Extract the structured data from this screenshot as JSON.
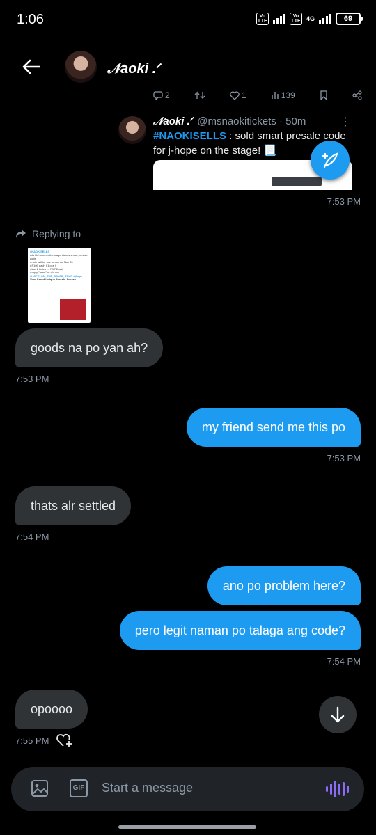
{
  "status_bar": {
    "time": "1:06",
    "volte_label": "Vo LTE",
    "network": "4G",
    "battery": "69"
  },
  "header": {
    "contact_name": "𝒩aoki .ᐟ"
  },
  "quoted_tweet": {
    "actions": {
      "replies": "2",
      "likes": "1",
      "views": "139"
    },
    "author": "𝒩aoki .ᐟ",
    "handle_time": "@msnaokitickets · 50m",
    "hashtag": "#NAOKISELLS",
    "text": " : sold smart presale code for j-hope on the stage! 📃",
    "timestamp": "7:53 PM"
  },
  "replying_to": {
    "label": "Replying to",
    "thumb_title": "#NAOKISELLS",
    "thumb_line1": "wts fib hope on the stage stands smart presale code",
    "thumb_line2": "• note will be use tomorrow Nov 20",
    "thumb_line3": "• P100 each ( 1 pcs )",
    "thumb_line4": "• last 2 batch → P1/P2 only",
    "thumb_line5": "• reply \"mine\" or d/o me",
    "thumb_tags": "#HOPE_ON_THE_STAGE_TOUR #jhope",
    "thumb_card": "Your Smart Unique Presale Access..."
  },
  "messages": [
    {
      "direction": "in",
      "text": "goods na po yan ah?",
      "time": "7:53 PM"
    },
    {
      "direction": "out",
      "text": "my friend send me this po",
      "time": "7:53 PM"
    },
    {
      "direction": "in",
      "text": "thats alr settled",
      "time": "7:54 PM"
    },
    {
      "direction": "out",
      "text": "ano po problem here?",
      "time": ""
    },
    {
      "direction": "out",
      "text": "pero legit naman po talaga ang code?",
      "time": "7:54 PM"
    },
    {
      "direction": "in",
      "text": "opoooo",
      "time": "7:55 PM"
    }
  ],
  "composer": {
    "placeholder": "Start a message",
    "gif_label": "GIF"
  },
  "colors": {
    "accent": "#1d9bf0",
    "incoming_bubble": "#2f3336",
    "voice_icon": "#8c6cf7"
  }
}
